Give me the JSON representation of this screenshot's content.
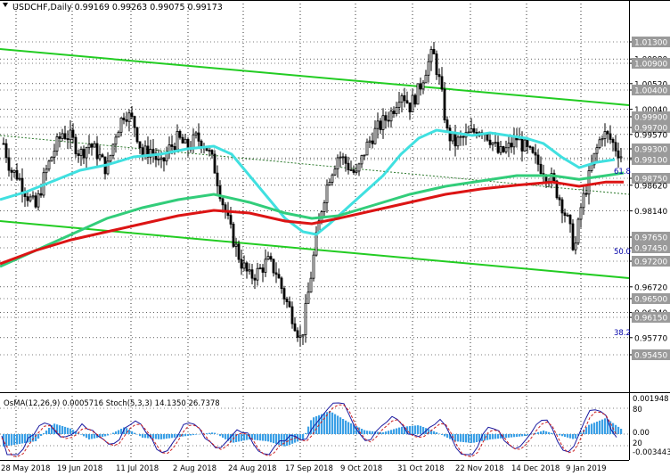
{
  "header": {
    "symbol_line": "USDCHF,Daily  0.99169 0.99263 0.99075 0.99173"
  },
  "osma_panel": {
    "label": "OsMA(12,26,9) 0.0005716  Stoch(5,3,3) 14.1350 26.7378",
    "axis": [
      "0.001948",
      "80",
      "0.00",
      "20",
      "-0.003443"
    ]
  },
  "price_axis": {
    "labels": [
      "1.01300",
      "1.00980",
      "1.00900",
      "1.00520",
      "1.00400",
      "1.00040",
      "0.99900",
      "0.99700",
      "0.99570",
      "0.99300",
      "0.99130",
      "0.99100",
      "0.98750",
      "0.98620",
      "0.98140",
      "0.97650",
      "0.97450",
      "0.97200",
      "0.96720",
      "0.96500",
      "0.96240",
      "0.96150",
      "0.95770",
      "0.95450"
    ],
    "highlighted": [
      "1.01300",
      "1.00900",
      "1.00400",
      "0.99900",
      "0.99700",
      "0.99300",
      "0.99100",
      "0.98750",
      "0.97650",
      "0.97450",
      "0.97200",
      "0.96500",
      "0.96150",
      "0.95450"
    ]
  },
  "fib_labels": {
    "f618": "61.8",
    "f500": "50.0",
    "f382": "38.2"
  },
  "date_axis": [
    "28 May 2018",
    "19 Jun 2018",
    "11 Jul 2018",
    "2 Aug 2018",
    "24 Aug 2018",
    "17 Sep 2018",
    "9 Oct 2018",
    "31 Oct 2018",
    "22 Nov 2018",
    "14 Dec 2018",
    "9 Jan 2019"
  ],
  "colors": {
    "bull": "#000000",
    "bear": "#000000",
    "ema_fast": "#40e0e0",
    "ema_mid": "#32cd7a",
    "ema_slow": "#dc1414",
    "channel": "#22cc22",
    "grid": "#000000",
    "osma": "#3ba0e6",
    "stoch_main": "#1a1aa0",
    "stoch_signal": "#cc2020"
  }
}
